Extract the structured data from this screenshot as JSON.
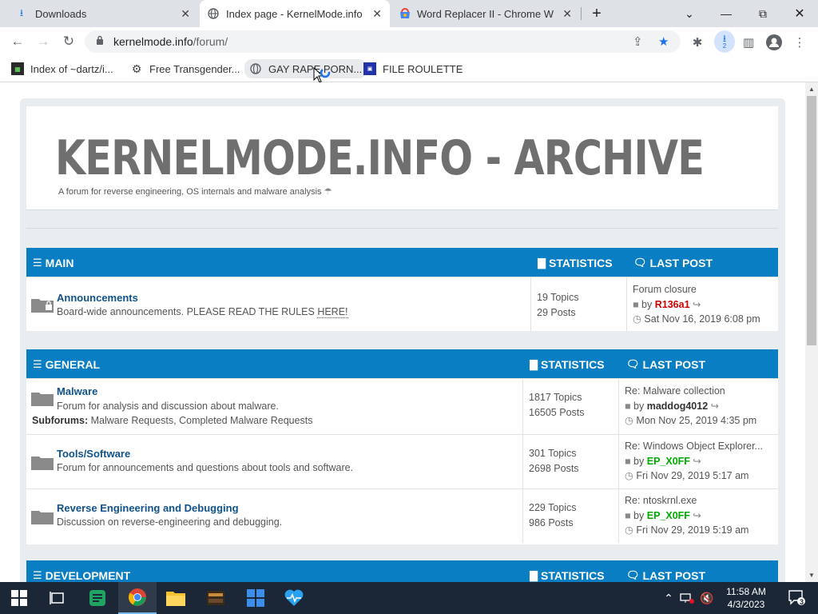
{
  "tabs": [
    {
      "label": "Downloads",
      "icon": "download-icon",
      "active": false
    },
    {
      "label": "Index page - KernelMode.info",
      "icon": "globe-icon",
      "active": true
    },
    {
      "label": "Word Replacer II - Chrome W",
      "icon": "chrome-webstore-icon",
      "active": false
    }
  ],
  "toolbar": {
    "url_host": "kernelmode.info",
    "url_path": "/forum/",
    "download_badge": "2"
  },
  "bookmarks": [
    {
      "label": "Index of ~dartz/i...",
      "icon": "favicon-icon"
    },
    {
      "label": "Free Transgender...",
      "icon": "favicon-icon"
    },
    {
      "label": "GAY RAPE PORN...",
      "icon": "globe-icon"
    },
    {
      "label": "FILE ROULETTE",
      "icon": "favicon-icon"
    }
  ],
  "site": {
    "title": "KERNELMODE.INFO - ARCHIVE",
    "description": "A forum for reverse engineering, OS internals and malware analysis"
  },
  "headers": {
    "statistics": "STATISTICS",
    "last_post": "LAST POST"
  },
  "blocks": [
    {
      "name": "MAIN",
      "forums": [
        {
          "title": "Announcements",
          "desc_prefix": "Board-wide announcements. PLEASE READ THE RULES ",
          "desc_link": "HERE!",
          "topics": "19 Topics",
          "posts": "29 Posts",
          "last_title": "Forum closure",
          "last_by": "by",
          "last_user": "R136a1",
          "last_user_color": "#cc0000",
          "last_date": "Sat Nov 16, 2019 6:08 pm"
        }
      ]
    },
    {
      "name": "GENERAL",
      "forums": [
        {
          "title": "Malware",
          "desc": "Forum for analysis and discussion about malware.",
          "sub_label": "Subforums:",
          "sub_items": "Malware Requests, Completed Malware Requests",
          "topics": "1817 Topics",
          "posts": "16505 Posts",
          "last_title": "Re: Malware collection",
          "last_by": "by",
          "last_user": "maddog4012",
          "last_user_color": "#333333",
          "last_date": "Mon Nov 25, 2019 4:35 pm"
        },
        {
          "title": "Tools/Software",
          "desc": "Forum for announcements and questions about tools and software.",
          "topics": "301 Topics",
          "posts": "2698 Posts",
          "last_title": "Re: Windows Object Explorer...",
          "last_by": "by",
          "last_user": "EP_X0FF",
          "last_user_color": "#00aa00",
          "last_date": "Fri Nov 29, 2019 5:17 am"
        },
        {
          "title": "Reverse Engineering and Debugging",
          "desc": "Discussion on reverse-engineering and debugging.",
          "topics": "229 Topics",
          "posts": "986 Posts",
          "last_title": "Re: ntoskrnl.exe",
          "last_by": "by",
          "last_user": "EP_X0FF",
          "last_user_color": "#00aa00",
          "last_date": "Fri Nov 29, 2019 5:19 am"
        }
      ]
    },
    {
      "name": "DEVELOPMENT",
      "forums": []
    }
  ],
  "taskbar": {
    "time": "11:58 AM",
    "date": "4/3/2023",
    "notification_count": "3"
  }
}
